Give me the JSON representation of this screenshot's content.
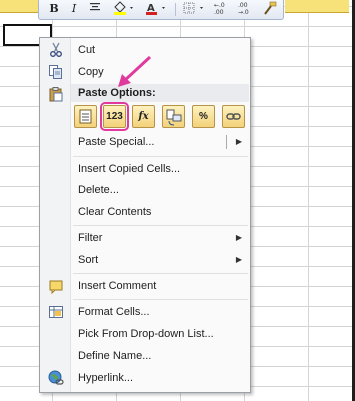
{
  "mini_toolbar": {
    "bold": "B",
    "italic": "I",
    "icons": [
      "bold-icon",
      "italic-icon",
      "align-center-icon",
      "fill-color-icon",
      "font-color-icon",
      "borders-icon",
      "increase-decimal-icon",
      "decrease-decimal-icon",
      "format-painter-icon"
    ]
  },
  "context_menu": {
    "cut": "Cut",
    "copy": "Copy",
    "paste_options_header": "Paste Options:",
    "paste_options": [
      "Paste",
      "Values",
      "Formulas",
      "Transpose",
      "Formatting",
      "Paste Link"
    ],
    "paste_special": "Paste Special...",
    "insert_copied_cells": "Insert Copied Cells...",
    "delete": "Delete...",
    "clear_contents": "Clear Contents",
    "filter": "Filter",
    "sort": "Sort",
    "insert_comment": "Insert Comment",
    "format_cells": "Format Cells...",
    "pick_from_dropdown": "Pick From Drop-down List...",
    "define_name": "Define Name...",
    "hyperlink": "Hyperlink..."
  },
  "paste_values_text": "123",
  "fx_text": "fx",
  "percent_text": "%",
  "colors": {
    "annotation": "#e03a9e",
    "paste_icon": "#f3d27a",
    "gutter": "#f2f3f5"
  }
}
